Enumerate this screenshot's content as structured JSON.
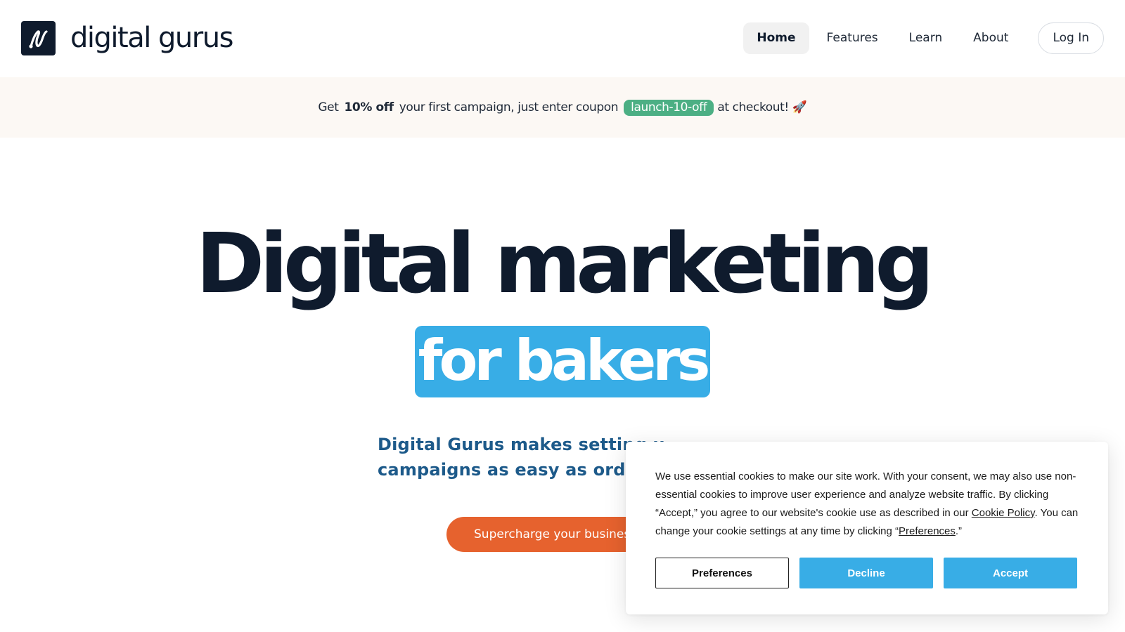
{
  "brand": {
    "name": "digital gurus",
    "logo_icon": "dg-swirl-logo-icon"
  },
  "nav": {
    "items": [
      {
        "label": "Home",
        "active": true
      },
      {
        "label": "Features",
        "active": false
      },
      {
        "label": "Learn",
        "active": false
      },
      {
        "label": "About",
        "active": false
      }
    ],
    "login_label": "Log In"
  },
  "promo": {
    "prefix": "Get",
    "bold": "10% off",
    "middle": "your first campaign, just enter coupon",
    "coupon": "launch-10-off",
    "suffix": "at checkout!",
    "emoji": "🚀"
  },
  "hero": {
    "title": "Digital marketing",
    "highlight": "for bakers",
    "subtitle_line1": "Digital Gurus makes setting u",
    "subtitle_line2": "campaigns as easy as orderin",
    "cta_label": "Supercharge your business"
  },
  "cookie": {
    "text_part1": "We use essential cookies to make our site work. With your consent, we may also use non-essential cookies to improve user experience and analyze website traffic. By clicking “Accept,” you agree to our website's cookie use as described in our ",
    "policy_link": "Cookie Policy",
    "text_part2": ". You can change your cookie settings at any time by clicking “",
    "preferences_link": "Preferences",
    "text_part3": ".”",
    "preferences_button": "Preferences",
    "decline_button": "Decline",
    "accept_button": "Accept"
  },
  "colors": {
    "navy": "#0f1b2d",
    "accent_blue": "#38ade6",
    "coupon_green": "#4caf84",
    "cta_orange": "#e6622e",
    "subtitle_blue": "#1d5a8a",
    "promo_bg": "#fcf8f4"
  }
}
